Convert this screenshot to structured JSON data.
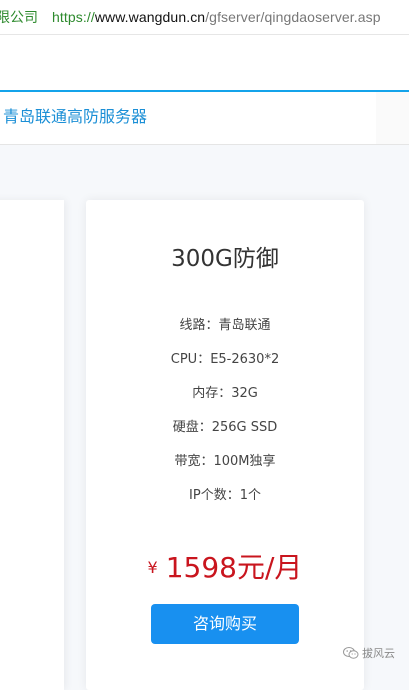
{
  "browser": {
    "url_prefix": "限公司",
    "url_scheme": "https://",
    "url_host": "www.wangdun.cn",
    "url_path": "/gfserver/qingdaoserver.asp"
  },
  "tabs": {
    "active_label": "青岛联通高防服务器"
  },
  "product": {
    "title": "300G防御",
    "specs": [
      "线路：青岛联通",
      "CPU：E5-2630*2",
      "内存：32G",
      "硬盘：256G SSD",
      "带宽：100M独享",
      "IP个数：1个"
    ],
    "currency_symbol": "¥",
    "price": "1598元/月",
    "buy_label": "咨询购买"
  },
  "watermark": {
    "text": "拔风云",
    "icon": "wechat-icon"
  },
  "colors": {
    "accent": "#1890f0",
    "tab_text": "#1b8fd6",
    "price": "#c9151e",
    "url_green": "#2d8a2d"
  }
}
